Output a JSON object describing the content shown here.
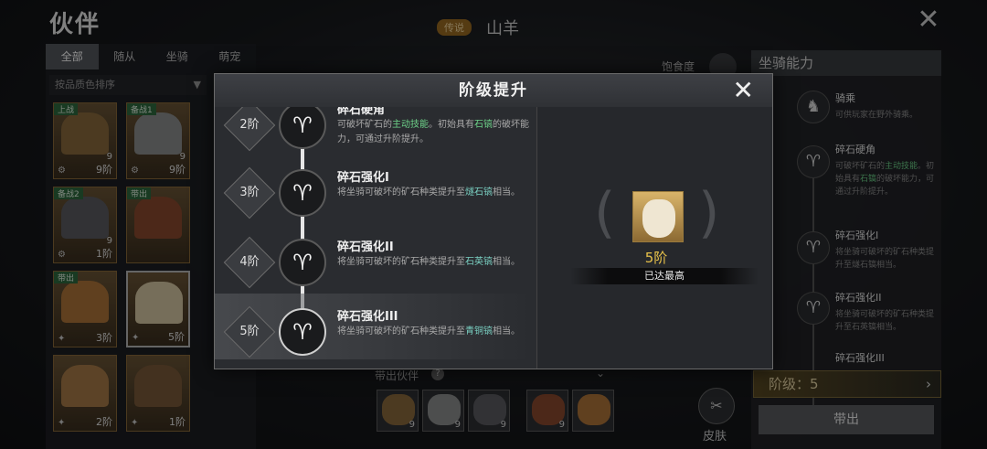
{
  "header": {
    "title": "伙伴",
    "name_badge": "传说",
    "name": "山羊"
  },
  "tabs": [
    "全部",
    "随从",
    "坐骑",
    "萌宠"
  ],
  "sort": {
    "label": "按品质色排序",
    "arrow": "▼",
    "toggle": "↓↑"
  },
  "cards": [
    {
      "tag": "上战",
      "num": "9",
      "lvl": "9阶",
      "color": "#8a6a3c"
    },
    {
      "tag": "备战1",
      "num": "9",
      "lvl": "9阶",
      "color": "#8d8e8e"
    },
    {
      "tag": "备战2",
      "num": "9",
      "lvl": "1阶",
      "color": "#5b5c62"
    },
    {
      "tag": "带出",
      "num": "",
      "lvl": "",
      "color": "#8a4a2e"
    },
    {
      "tag": "带出",
      "num": "",
      "lvl": "3阶",
      "color": "#b0763a"
    },
    {
      "tag": "",
      "num": "",
      "lvl": "5阶",
      "color": "#d8c8a4"
    },
    {
      "tag": "",
      "num": "",
      "lvl": "2阶",
      "color": "#a87a48"
    },
    {
      "tag": "",
      "num": "",
      "lvl": "1阶",
      "color": "#7a5a3a"
    }
  ],
  "satiety_label": "饱食度",
  "right_panel": {
    "title": "坐骑能力",
    "items": [
      {
        "title": "骑乘",
        "desc": "可供玩家在野外骑乘。"
      },
      {
        "title": "碎石硬角",
        "desc_pre": "可破坏矿石的",
        "desc_hl": "主动技能",
        "desc_mid": "。初始具有",
        "desc_hl2": "石镐",
        "desc_post": "的破坏能力，可通过升阶提升。"
      },
      {
        "title": "碎石强化I",
        "desc": "将坐骑可破坏的矿石种类提升至燧石镐相当。"
      },
      {
        "title": "碎石强化II",
        "desc": "将坐骑可破坏的矿石种类提升至石英镐相当。"
      },
      {
        "title": "碎石强化III",
        "desc": ""
      }
    ],
    "grade_label": "阶级：5",
    "deploy_label": "带出"
  },
  "partners": {
    "label": "带出伙伴",
    "help": "?",
    "nums": [
      "9",
      "9",
      "9",
      "9",
      "",
      ""
    ]
  },
  "skin_label": "皮肤",
  "modal": {
    "title": "阶级提升",
    "close": "✕",
    "tiers": [
      {
        "tier": "2阶",
        "name": "碎石硬角",
        "desc_pre": "可破坏矿石的",
        "desc_hl": "主动技能",
        "desc_mid": "。初始具有",
        "desc_hl2": "石镐",
        "desc_post": "的破坏能力，可通过升阶提升。"
      },
      {
        "tier": "3阶",
        "name": "碎石强化I",
        "desc_pre": "将坐骑可破坏的矿石种类提升至",
        "desc_hl": "燧石镐",
        "desc_post": "相当。"
      },
      {
        "tier": "4阶",
        "name": "碎石强化II",
        "desc_pre": "将坐骑可破坏的矿石种类提升至",
        "desc_hl": "石英镐",
        "desc_post": "相当。"
      },
      {
        "tier": "5阶",
        "name": "碎石强化III",
        "desc_pre": "将坐骑可破坏的矿石种类提升至",
        "desc_hl": "青铜镐",
        "desc_post": "相当。"
      }
    ],
    "current_level": "5阶",
    "max_note": "已达最高"
  },
  "close_main": "✕"
}
